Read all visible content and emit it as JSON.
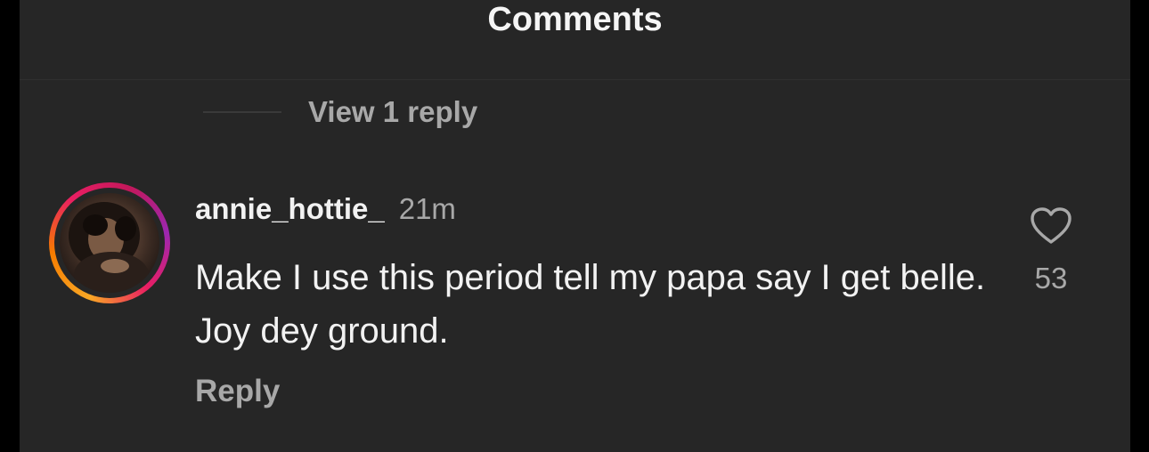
{
  "header": {
    "title": "Comments"
  },
  "thread": {
    "view_replies_label": "View 1 reply"
  },
  "comment": {
    "username": "annie_hottie_",
    "time": "21m",
    "text": "Make I use this period tell my papa say I get belle. Joy dey ground.",
    "reply_label": "Reply",
    "like_count": "53",
    "like_icon": "heart-outline-icon"
  },
  "colors": {
    "background": "#262626",
    "text_primary": "#f2f2f2",
    "text_secondary": "#a8a8a8",
    "story_ring": [
      "#f9a825",
      "#e91e63",
      "#9c27b0"
    ]
  }
}
